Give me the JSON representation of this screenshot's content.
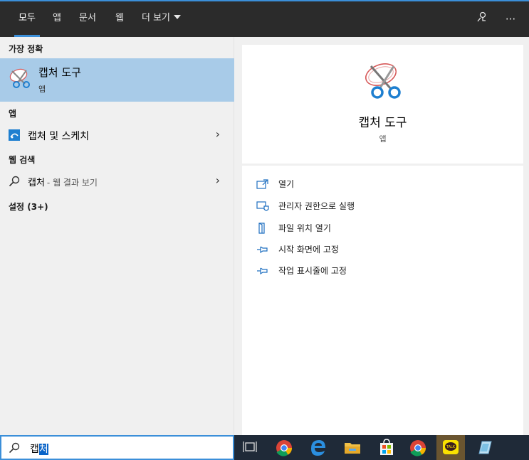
{
  "tabs": [
    {
      "label": "모두",
      "active": true
    },
    {
      "label": "앱"
    },
    {
      "label": "문서"
    },
    {
      "label": "웹"
    },
    {
      "label": "더 보기"
    }
  ],
  "top_icons": {
    "feedback": "feedback-icon",
    "more": "···"
  },
  "left": {
    "best_match_header": "가장 정확",
    "best_match": {
      "title": "캡처 도구",
      "subtitle": "앱",
      "icon": "snipping-tool-icon"
    },
    "apps_header": "앱",
    "apps": [
      {
        "label": "캡처 및 스케치",
        "icon": "snip-sketch-icon"
      }
    ],
    "web_header": "웹 검색",
    "web": [
      {
        "label": "캡처",
        "suffix": "- 웹 결과 보기",
        "icon": "search-icon"
      }
    ],
    "settings_header": "설정 (3+)"
  },
  "preview": {
    "title": "캡처 도구",
    "subtitle": "앱",
    "icon": "snipping-tool-icon",
    "actions": [
      {
        "label": "열기",
        "icon": "open-icon"
      },
      {
        "label": "관리자 권한으로 실행",
        "icon": "run-as-admin-icon"
      },
      {
        "label": "파일 위치 열기",
        "icon": "file-location-icon"
      },
      {
        "label": "시작 화면에 고정",
        "icon": "pin-icon"
      },
      {
        "label": "작업 표시줄에 고정",
        "icon": "pin-taskbar-icon"
      }
    ]
  },
  "search": {
    "query_plain": "캡",
    "query_selected": "처"
  },
  "taskbar": [
    {
      "name": "task-view-icon"
    },
    {
      "name": "chrome-icon"
    },
    {
      "name": "edge-icon"
    },
    {
      "name": "file-explorer-icon"
    },
    {
      "name": "store-icon"
    },
    {
      "name": "chrome-icon"
    },
    {
      "name": "kakaotalk-icon",
      "active": true
    },
    {
      "name": "app-icon"
    }
  ],
  "colors": {
    "accent": "#3b8fd9",
    "selected_row": "#a8cbe8",
    "topbar": "#2b2b2b",
    "taskbar": "#1f2a38"
  }
}
